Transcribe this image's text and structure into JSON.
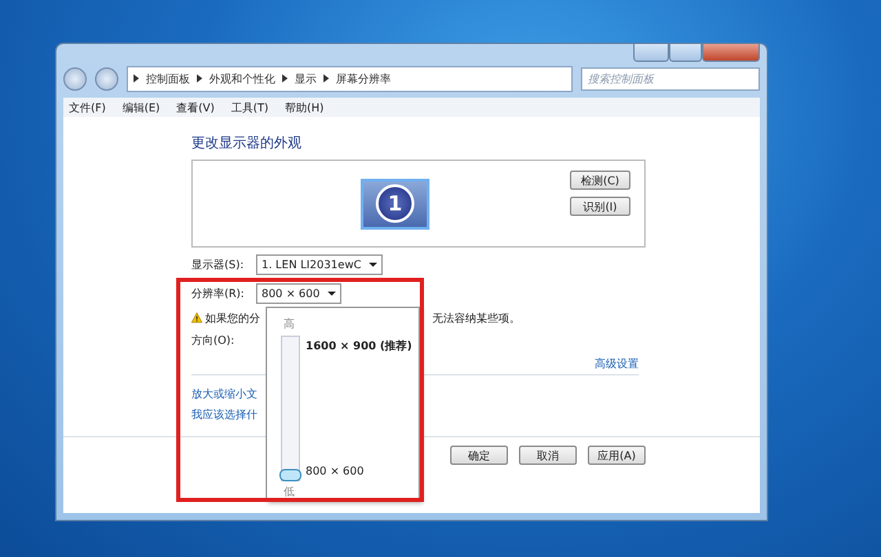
{
  "address_bar": {
    "crumbs": [
      "控制面板",
      "外观和个性化",
      "显示",
      "屏幕分辨率"
    ],
    "search_placeholder": "搜索控制面板"
  },
  "menu": [
    "文件(F)",
    "编辑(E)",
    "查看(V)",
    "工具(T)",
    "帮助(H)"
  ],
  "heading": "更改显示器的外观",
  "preview": {
    "monitor_number": "1",
    "buttons": [
      "检测(C)",
      "识别(I)"
    ]
  },
  "fields": [
    {
      "label": "显示器(S):",
      "value": "1. LEN LI2031ewC"
    },
    {
      "label": "分辨率(R):",
      "value": "800 × 600"
    }
  ],
  "warning": {
    "text_start": "如果您的分",
    "text_end": "无法容纳某些项。"
  },
  "orientation_label": "方向(O):",
  "advanced_link": "高级设置",
  "links": [
    "放大或缩小文",
    "我应该选择什"
  ],
  "buttons": [
    "确定",
    "取消",
    "应用(A)"
  ],
  "resolution_popup": {
    "high_label": "高",
    "low_label": "低",
    "max_label": "1600 × 900 (推荐)",
    "min_label": "800 × 600",
    "level": 0
  },
  "highlight": {
    "color": "#e02020"
  }
}
